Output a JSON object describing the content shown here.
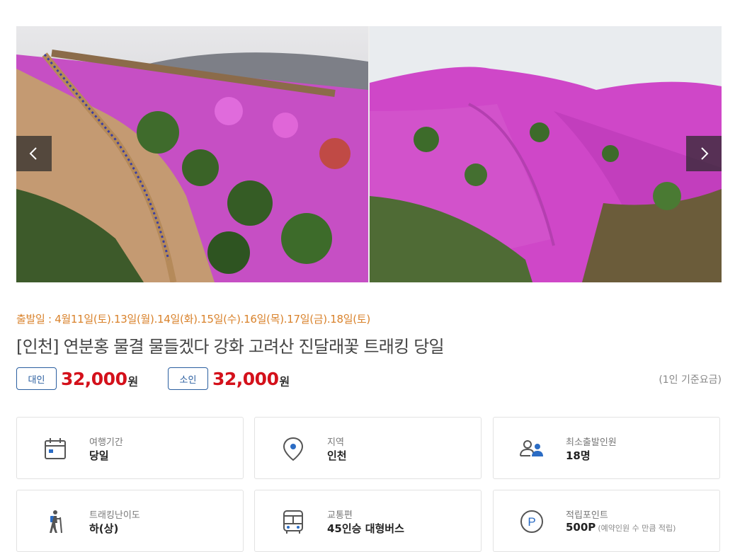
{
  "product": {
    "departure": "출발일 : 4월11일(토).13일(월).14일(화).15일(수).16일(목).17일(금).18일(토)",
    "title": "[인천] 연분홍 물결 물들겠다 강화 고려산 진달래꽃 트래킹 당일"
  },
  "gallery": {
    "prev_icon": "chevron-left-icon",
    "next_icon": "chevron-right-icon"
  },
  "pricing": {
    "adult_label": "대인",
    "adult_price": "32,000",
    "child_label": "소인",
    "child_price": "32,000",
    "unit": "원",
    "note": "(1인 기준요금)"
  },
  "info_cards": [
    {
      "icon": "calendar-icon",
      "label": "여행기간",
      "value": "당일"
    },
    {
      "icon": "location-pin-icon",
      "label": "지역",
      "value": "인천"
    },
    {
      "icon": "people-icon",
      "label": "최소출발인원",
      "value": "18명"
    },
    {
      "icon": "hiker-icon",
      "label": "트래킹난이도",
      "value": "하(상)"
    },
    {
      "icon": "bus-icon",
      "label": "교통편",
      "value": "45인승 대형버스"
    },
    {
      "icon": "points-icon",
      "label": "적립포인트",
      "value": "500P",
      "sub": "(예약인원 수 만큼 적립)"
    }
  ],
  "colors": {
    "accent_orange": "#d9822b",
    "price_red": "#d4111b",
    "badge_blue": "#2b5fa0",
    "azalea_pink": "#d64bd0"
  }
}
